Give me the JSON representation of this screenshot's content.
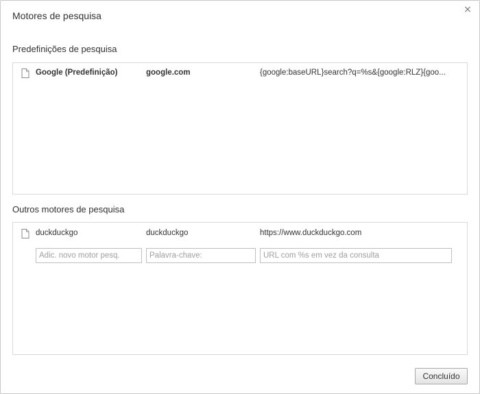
{
  "dialog": {
    "title": "Motores de pesquisa",
    "close_glyph": "×"
  },
  "defaults": {
    "heading": "Predefinições de pesquisa",
    "rows": [
      {
        "icon": "document-icon",
        "name": "Google (Predefinição)",
        "keyword": "google.com",
        "url": "{google:baseURL}search?q=%s&{google:RLZ}{goo..."
      }
    ]
  },
  "others": {
    "heading": "Outros motores de pesquisa",
    "rows": [
      {
        "icon": "document-icon",
        "name": "duckduckgo",
        "keyword": "duckduckgo",
        "url": "https://www.duckduckgo.com"
      }
    ],
    "new_entry": {
      "name_placeholder": "Adic. novo motor pesq.",
      "keyword_placeholder": "Palavra-chave:",
      "url_placeholder": "URL com %s em vez da consulta",
      "name_value": "",
      "keyword_value": "",
      "url_value": ""
    }
  },
  "footer": {
    "done_label": "Concluído"
  },
  "colors": {
    "border": "#d9d9d9",
    "text": "#303030",
    "placeholder": "#a0a0a0"
  }
}
